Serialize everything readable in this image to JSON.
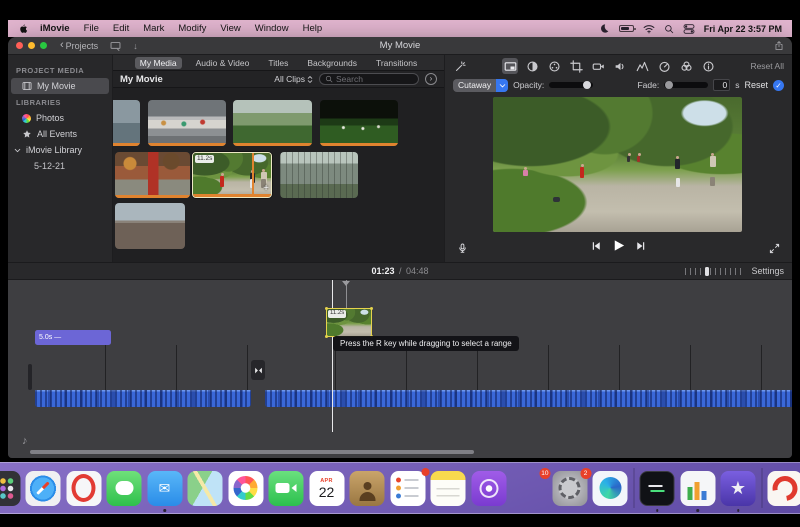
{
  "menu_bar": {
    "items": [
      "iMovie",
      "File",
      "Edit",
      "Mark",
      "Modify",
      "View",
      "Window",
      "Help"
    ],
    "clock": "Fri Apr 22  3:57 PM"
  },
  "titlebar": {
    "back_label": "Projects",
    "title": "My Movie"
  },
  "sidebar": {
    "project_media_header": "PROJECT MEDIA",
    "my_movie_label": "My Movie",
    "libraries_header": "LIBRARIES",
    "photos_label": "Photos",
    "all_events_label": "All Events",
    "imovie_library_label": "iMovie Library",
    "event_label": "5-12-21"
  },
  "browser": {
    "tabs": [
      {
        "label": "My Media",
        "selected": true
      },
      {
        "label": "Audio & Video",
        "selected": false
      },
      {
        "label": "Titles",
        "selected": false
      },
      {
        "label": "Backgrounds",
        "selected": false
      },
      {
        "label": "Transitions",
        "selected": false
      }
    ],
    "collection_title": "My Movie",
    "filter_label": "All Clips",
    "search_placeholder": "Search",
    "selected_clip_badge": "11.2s"
  },
  "inspector": {
    "toolbar_icons": [
      "wand",
      "overlay",
      "color-balance",
      "color-correction",
      "crop",
      "stabilization",
      "volume",
      "noise-reduction",
      "speed",
      "effects",
      "info"
    ],
    "reset_all_label": "Reset All",
    "overlay_mode_label": "Cutaway",
    "opacity_label": "Opacity:",
    "fade_label": "Fade:",
    "fade_value": "0",
    "fade_unit_label": "s",
    "reset_label": "Reset"
  },
  "timeline": {
    "current_time": "01:23",
    "separator": "/",
    "total_time": "04:48",
    "settings_label": "Settings",
    "title_clip_label": "5.0s —",
    "drag_badge": "11.2s",
    "tooltip": "Press the R key while dragging to select a range"
  },
  "dock": {
    "items": [
      {
        "name": "finder",
        "running": true
      },
      {
        "name": "launchpad"
      },
      {
        "name": "safari"
      },
      {
        "name": "opera"
      },
      {
        "name": "messages"
      },
      {
        "name": "mail",
        "running": true
      },
      {
        "name": "maps"
      },
      {
        "name": "photos"
      },
      {
        "name": "facetime"
      },
      {
        "name": "calendar",
        "month": "APR",
        "day": "22"
      },
      {
        "name": "contacts"
      },
      {
        "name": "reminders",
        "badge": ""
      },
      {
        "name": "notes"
      },
      {
        "name": "podcasts"
      },
      {
        "name": "app-store",
        "badge": "10"
      },
      {
        "name": "system-settings",
        "badge": "2"
      },
      {
        "name": "edge"
      },
      {
        "name": "separator"
      },
      {
        "name": "terminal",
        "running": true
      },
      {
        "name": "numbers",
        "running": true
      },
      {
        "name": "imovie",
        "running": true
      },
      {
        "name": "separator"
      },
      {
        "name": "downloads"
      },
      {
        "name": "mini-file"
      },
      {
        "name": "trash"
      }
    ]
  },
  "colors": {
    "accent_blue": "#3677f0",
    "selection_yellow": "#e6d34c",
    "used_media_orange": "#e0832f",
    "menubar_pink": "#e2b5cf",
    "dock_purple": "#8a70d6",
    "waveform_blue": "#3a68d8",
    "title_clip_purple": "#6c66d6"
  }
}
